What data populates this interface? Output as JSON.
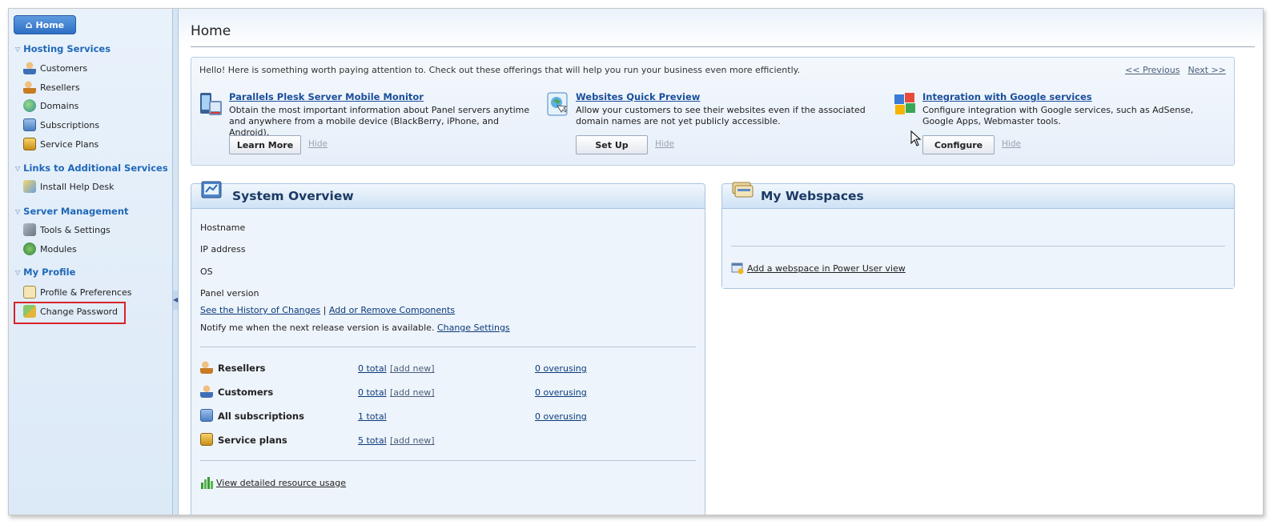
{
  "sidebar": {
    "home_label": "Home",
    "sections": [
      {
        "title": "Hosting Services",
        "items": [
          "Customers",
          "Resellers",
          "Domains",
          "Subscriptions",
          "Service Plans"
        ]
      },
      {
        "title": "Links to Additional Services",
        "items": [
          "Install Help Desk"
        ]
      },
      {
        "title": "Server Management",
        "items": [
          "Tools & Settings",
          "Modules"
        ]
      },
      {
        "title": "My Profile",
        "items": [
          "Profile & Preferences",
          "Change Password"
        ]
      }
    ]
  },
  "page": {
    "title": "Home"
  },
  "promo": {
    "message": "Hello! Here is something worth paying attention to. Check out these offerings that will help you run your business even more efficiently.",
    "prev_label": "<< Previous",
    "next_label": "Next >>",
    "offers": [
      {
        "title": "Parallels Plesk Server Mobile Monitor",
        "desc": "Obtain the most important information about Panel servers anytime and anywhere from a mobile device (BlackBerry, iPhone, and Android).",
        "button": "Learn More",
        "hide": "Hide",
        "icon": "mobile-monitor-icon"
      },
      {
        "title": "Websites Quick Preview",
        "desc": "Allow your customers to see their websites even if the associated domain names are not yet publicly accessible.",
        "button": "Set Up",
        "hide": "Hide",
        "icon": "quick-preview-icon"
      },
      {
        "title": "Integration with Google services",
        "desc": "Configure integration with Google services, such as AdSense, Google Apps, Webmaster tools.",
        "button": "Configure",
        "hide": "Hide",
        "icon": "google-icon"
      }
    ]
  },
  "system_overview": {
    "title": "System Overview",
    "rows": [
      "Hostname",
      "IP address",
      "OS",
      "Panel version"
    ],
    "history_link": "See the History of Changes",
    "separator": "|",
    "components_link": "Add or Remove Components",
    "notify_text": "Notify me when the next release version is available.",
    "change_settings_link": "Change Settings",
    "resources": [
      {
        "name": "Resellers",
        "total": "0 total",
        "add": "[add new]",
        "over": "0 overusing"
      },
      {
        "name": "Customers",
        "total": "0 total",
        "add": "[add new]",
        "over": "0 overusing"
      },
      {
        "name": "All subscriptions",
        "total": "1 total",
        "add": "",
        "over": "0 overusing"
      },
      {
        "name": "Service plans",
        "total": "5 total",
        "add": "[add new]",
        "over": ""
      }
    ],
    "usage_link": "View detailed resource usage"
  },
  "webspaces": {
    "title": "My Webspaces",
    "add_link": "Add a webspace in Power User view"
  },
  "colors": {
    "accent": "#1f68b8",
    "highlight": "#d9232a"
  }
}
